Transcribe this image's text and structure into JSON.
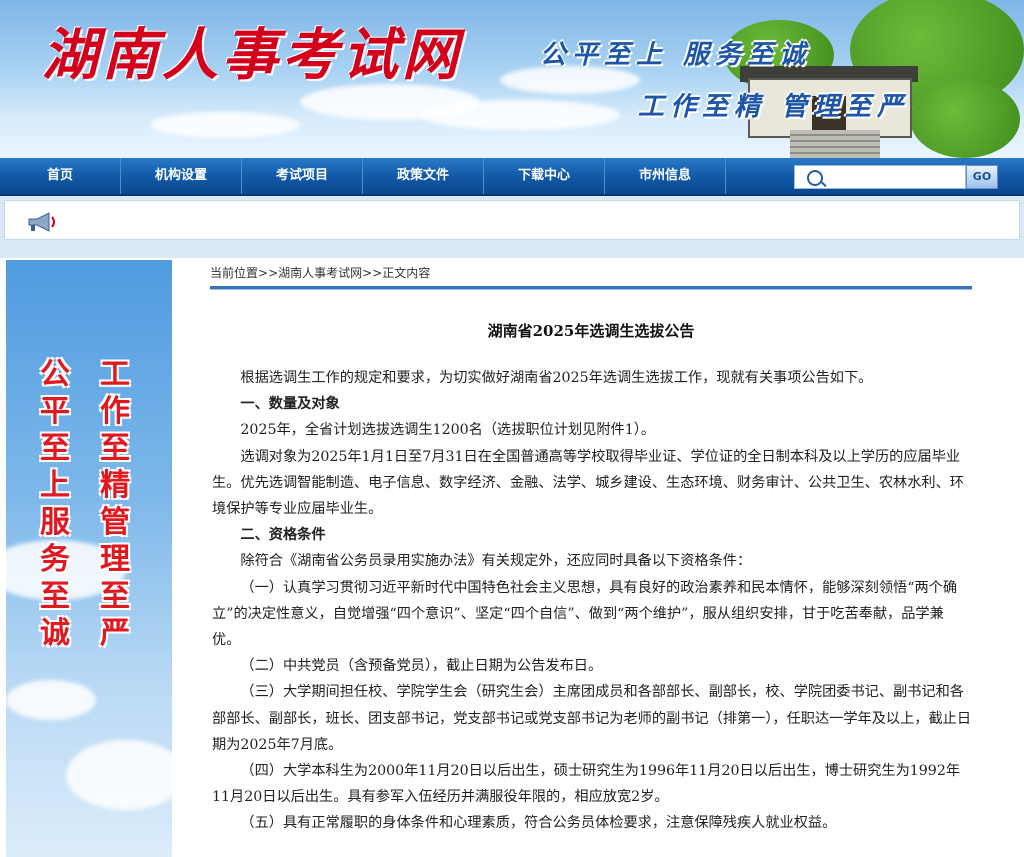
{
  "header": {
    "site_title": "湖南人事考试网",
    "slogan_line1": "公平至上 服务至诚",
    "slogan_line2": "工作至精 管理至严"
  },
  "nav": {
    "items": [
      "首页",
      "机构设置",
      "考试项目",
      "政策文件",
      "下载中心",
      "市州信息"
    ],
    "search": {
      "value": "",
      "placeholder": ""
    },
    "go_label": "GO"
  },
  "left_banner": {
    "col1": "公平至上　服务至诚",
    "col2": "工作至精　管理至严"
  },
  "breadcrumb": {
    "label": "当前位置",
    "sep": ">>",
    "home": "湖南人事考试网",
    "current": "正文内容"
  },
  "article": {
    "title": "湖南省2025年选调生选拔公告",
    "paragraphs": [
      {
        "heading": false,
        "text": "根据选调生工作的规定和要求，为切实做好湖南省2025年选调生选拔工作，现就有关事项公告如下。"
      },
      {
        "heading": true,
        "text": "一、数量及对象"
      },
      {
        "heading": false,
        "text": "2025年，全省计划选拔选调生1200名（选拔职位计划见附件1）。"
      },
      {
        "heading": false,
        "text": "选调对象为2025年1月1日至7月31日在全国普通高等学校取得毕业证、学位证的全日制本科及以上学历的应届毕业生。优先选调智能制造、电子信息、数字经济、金融、法学、城乡建设、生态环境、财务审计、公共卫生、农林水利、环境保护等专业应届毕业生。"
      },
      {
        "heading": true,
        "text": "二、资格条件"
      },
      {
        "heading": false,
        "text": "除符合《湖南省公务员录用实施办法》有关规定外，还应同时具备以下资格条件："
      },
      {
        "heading": false,
        "text": "（一）认真学习贯彻习近平新时代中国特色社会主义思想，具有良好的政治素养和民本情怀，能够深刻领悟“两个确立”的决定性意义，自觉增强“四个意识”、坚定“四个自信”、做到“两个维护”，服从组织安排，甘于吃苦奉献，品学兼优。"
      },
      {
        "heading": false,
        "text": "（二）中共党员（含预备党员），截止日期为公告发布日。"
      },
      {
        "heading": false,
        "text": "（三）大学期间担任校、学院学生会（研究生会）主席团成员和各部部长、副部长，校、学院团委书记、副书记和各部部长、副部长，班长、团支部书记，党支部书记或党支部书记为老师的副书记（排第一），任职达一学年及以上，截止日期为2025年7月底。"
      },
      {
        "heading": false,
        "text": "（四）大学本科生为2000年11月20日以后出生，硕士研究生为1996年11月20日以后出生，博士研究生为1992年11月20日以后出生。具有参军入伍经历并满服役年限的，相应放宽2岁。"
      },
      {
        "heading": false,
        "text": "（五）具有正常履职的身体条件和心理素质，符合公务员体检要求，注意保障残疾人就业权益。"
      }
    ]
  }
}
